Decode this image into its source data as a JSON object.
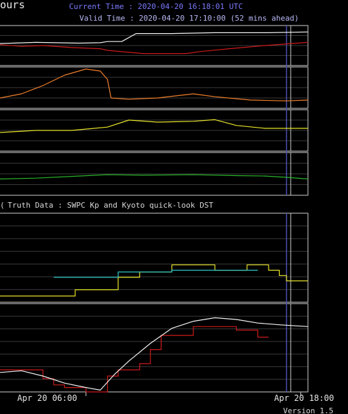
{
  "header": {
    "title_fragment": "ours",
    "current_time": "Current Time : 2020-04-20 16:18:01 UTC",
    "valid_time": "Valid Time : 2020-04-20 17:10:00 (52 mins ahead)"
  },
  "colors": {
    "background": "#000000",
    "frame": "#cfcfcf",
    "grid": "#3a3a3a",
    "current_marker": "#4a4fb0",
    "header_current": "#7a7aff",
    "header_valid": "#b8b8f5",
    "white": "#f2f2f2",
    "red": "#cc1b1b",
    "orange": "#f07f2b",
    "yellow": "#e8e42a",
    "green": "#2bb52b",
    "cyan": "#2ec5c5"
  },
  "chart_data": [
    {
      "type": "line",
      "panel": "upper-1",
      "series": [
        {
          "color": "white",
          "values": [
            [
              0,
              0.55
            ],
            [
              10,
              0.58
            ],
            [
              22,
              0.56
            ],
            [
              28,
              0.57
            ],
            [
              30,
              0.6
            ],
            [
              34,
              0.6
            ],
            [
              38,
              0.8
            ],
            [
              48,
              0.8
            ],
            [
              60,
              0.82
            ],
            [
              75,
              0.82
            ],
            [
              86,
              0.84
            ]
          ]
        },
        {
          "color": "red",
          "values": [
            [
              0,
              0.52
            ],
            [
              6,
              0.48
            ],
            [
              12,
              0.5
            ],
            [
              20,
              0.45
            ],
            [
              28,
              0.42
            ],
            [
              30,
              0.38
            ],
            [
              40,
              0.3
            ],
            [
              52,
              0.3
            ],
            [
              56,
              0.35
            ],
            [
              64,
              0.42
            ],
            [
              74,
              0.5
            ],
            [
              86,
              0.58
            ]
          ]
        }
      ]
    },
    {
      "type": "line",
      "panel": "upper-2",
      "series": [
        {
          "color": "orange",
          "values": [
            [
              0,
              0.25
            ],
            [
              6,
              0.35
            ],
            [
              12,
              0.55
            ],
            [
              18,
              0.8
            ],
            [
              24,
              0.95
            ],
            [
              28,
              0.9
            ],
            [
              30,
              0.7
            ],
            [
              31,
              0.25
            ],
            [
              36,
              0.22
            ],
            [
              44,
              0.25
            ],
            [
              54,
              0.35
            ],
            [
              60,
              0.28
            ],
            [
              70,
              0.2
            ],
            [
              80,
              0.18
            ],
            [
              86,
              0.2
            ]
          ]
        }
      ]
    },
    {
      "type": "line",
      "panel": "upper-3",
      "series": [
        {
          "color": "yellow",
          "values": [
            [
              0,
              0.45
            ],
            [
              10,
              0.5
            ],
            [
              20,
              0.5
            ],
            [
              30,
              0.58
            ],
            [
              36,
              0.75
            ],
            [
              44,
              0.7
            ],
            [
              54,
              0.72
            ],
            [
              60,
              0.76
            ],
            [
              66,
              0.62
            ],
            [
              74,
              0.55
            ],
            [
              86,
              0.55
            ]
          ]
        }
      ]
    },
    {
      "type": "line",
      "panel": "upper-4",
      "series": [
        {
          "color": "green",
          "values": [
            [
              0,
              0.38
            ],
            [
              10,
              0.4
            ],
            [
              22,
              0.45
            ],
            [
              30,
              0.48
            ],
            [
              40,
              0.47
            ],
            [
              54,
              0.48
            ],
            [
              66,
              0.46
            ],
            [
              74,
              0.45
            ],
            [
              80,
              0.42
            ],
            [
              86,
              0.38
            ]
          ]
        }
      ]
    },
    {
      "type": "line",
      "panel": "kp",
      "title": "Truth Data : SWPC Kp and Kyoto quick-look DST",
      "title_prefix": "(",
      "series": [
        {
          "color": "yellow",
          "step": true,
          "values": [
            [
              0,
              0.07
            ],
            [
              15,
              0.07
            ],
            [
              21,
              0.14
            ],
            [
              33,
              0.28
            ],
            [
              39,
              0.34
            ],
            [
              48,
              0.42
            ],
            [
              54,
              0.42
            ],
            [
              60,
              0.36
            ],
            [
              69,
              0.42
            ],
            [
              75,
              0.36
            ],
            [
              78,
              0.3
            ],
            [
              80,
              0.24
            ],
            [
              86,
              0.24
            ]
          ]
        },
        {
          "color": "cyan",
          "step": true,
          "values": [
            [
              15,
              0.28
            ],
            [
              21,
              0.28
            ],
            [
              27,
              0.28
            ],
            [
              33,
              0.34
            ],
            [
              39,
              0.34
            ],
            [
              48,
              0.36
            ],
            [
              54,
              0.36
            ],
            [
              72,
              0.36
            ]
          ]
        }
      ]
    },
    {
      "type": "line",
      "panel": "dst",
      "series": [
        {
          "color": "red",
          "step": true,
          "values": [
            [
              0,
              0.25
            ],
            [
              9,
              0.25
            ],
            [
              12,
              0.15
            ],
            [
              15,
              0.08
            ],
            [
              18,
              0.05
            ],
            [
              24,
              0.0
            ],
            [
              27,
              0.0
            ],
            [
              30,
              0.18
            ],
            [
              33,
              0.25
            ],
            [
              39,
              0.32
            ],
            [
              42,
              0.48
            ],
            [
              45,
              0.64
            ],
            [
              51,
              0.64
            ],
            [
              54,
              0.74
            ],
            [
              63,
              0.74
            ],
            [
              66,
              0.7
            ],
            [
              72,
              0.62
            ],
            [
              75,
              0.62
            ]
          ]
        },
        {
          "color": "white",
          "values": [
            [
              0,
              0.22
            ],
            [
              6,
              0.24
            ],
            [
              12,
              0.18
            ],
            [
              18,
              0.1
            ],
            [
              24,
              0.05
            ],
            [
              28,
              0.02
            ],
            [
              32,
              0.2
            ],
            [
              36,
              0.35
            ],
            [
              42,
              0.55
            ],
            [
              48,
              0.72
            ],
            [
              54,
              0.8
            ],
            [
              60,
              0.84
            ],
            [
              66,
              0.82
            ],
            [
              72,
              0.78
            ],
            [
              78,
              0.76
            ],
            [
              86,
              0.74
            ]
          ]
        }
      ]
    }
  ],
  "x_axis": {
    "domain_hours": [
      0,
      86
    ],
    "now_hours": 80,
    "ticks": [
      {
        "hours": 24,
        "label": "Apr 20 06:00"
      },
      {
        "hours": 84,
        "label": "Apr 20 18:00"
      }
    ]
  },
  "footer": {
    "version": "Version 1.5"
  }
}
